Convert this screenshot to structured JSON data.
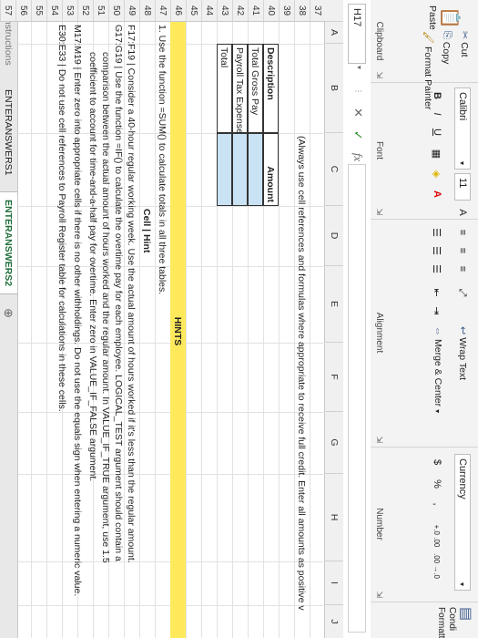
{
  "clipboard": {
    "cut_label": "Cut",
    "copy_label": "Copy",
    "paste_label": "Paste",
    "format_painter_label": "Format Painter",
    "group_label": "Clipboard"
  },
  "font": {
    "name": "Calibri",
    "size": "11",
    "bold": "B",
    "italic": "I",
    "underline": "U",
    "grow": "A",
    "shrink": "A",
    "group_label": "Font"
  },
  "alignment": {
    "wrap_text_label": "Wrap Text",
    "merge_center_label": "Merge & Center",
    "group_label": "Alignment"
  },
  "number": {
    "format": "Currency",
    "currency_symbol": "$",
    "percent_symbol": "%",
    "increase_decimal": "+.0 .00",
    "decrease_decimal": ".00 →.0",
    "group_label": "Number"
  },
  "styles": {
    "conditional_label": "Condi Formatt"
  },
  "formula_bar": {
    "name_box": "H17",
    "cancel": "✕",
    "enter": "✓",
    "fx": "fx"
  },
  "columns": [
    "A",
    "B",
    "C",
    "D",
    "E",
    "F",
    "G",
    "H",
    "I",
    "J"
  ],
  "rows": [
    "37",
    "38",
    "39",
    "40",
    "41",
    "42",
    "43",
    "44",
    "45",
    "46",
    "47",
    "48",
    "49",
    "50",
    "51",
    "52",
    "53",
    "54",
    "55",
    "56",
    "57",
    "58",
    "59"
  ],
  "cells": {
    "instruction": "(Always use cell references and formulas where appropriate to receive full credit. Enter all amounts as positive v",
    "desc_header": "Description",
    "amount_header": "Amount",
    "total_gross": "Total Gross Pay",
    "payroll_tax": "Payroll Tax Expense",
    "total": "Total",
    "hints": "HINTS",
    "hint1": "1. Use the function =SUM() to calculate totals in all three tables.",
    "cell_hint": "Cell  |  Hint",
    "hint49": "F17:F19  |  Consider a 40-hour regular working week. Use the actual amount of hours worked if it's less than the regular amount.",
    "hint49b": "G17:G19  |  Use the function =IF() to calculate the overtime pay for each employee. LOGICAL_TEST argument should contain a",
    "hint49c": "comparison between the actual amount of hours worked and the regular amount. In VALUE_IF_TRUE argument, use 1.5",
    "hint49d": "coefficient to account for time-and-a-half pay for overtime. Enter zero in VALUE_IF_FALSE argument.",
    "hint51": "M17:M19  |  Enter zero into appropriate cells if there is no other withholdings. Do not use the equals sign when entering a numeric value.",
    "hint52": "E30:E33  |  Do not use cell references to Payroll Register table for calculations in these cells."
  },
  "tabs": [
    "Instructions",
    "ENTERANSWERS1",
    "ENTERANSWERS2"
  ]
}
